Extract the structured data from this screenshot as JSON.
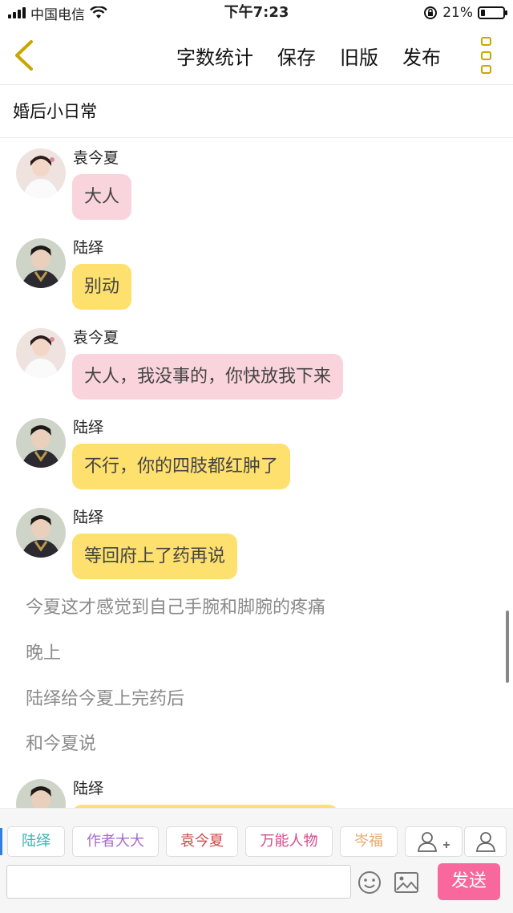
{
  "status_bar": {
    "carrier": "中国电信",
    "time": "下午7:23",
    "battery": "21%",
    "battery_level": 0.21
  },
  "toolbar": {
    "word_count_label": "字数统计",
    "save_label": "保存",
    "old_version_label": "旧版",
    "publish_label": "发布"
  },
  "story": {
    "title": "婚后小日常"
  },
  "messages": [
    {
      "speaker": "袁今夏",
      "text": "大人",
      "style": "pink"
    },
    {
      "speaker": "陆绎",
      "text": "别动",
      "style": "yellow"
    },
    {
      "speaker": "袁今夏",
      "text": "大人，我没事的，你快放我下来",
      "style": "pink"
    },
    {
      "speaker": "陆绎",
      "text": "不行，你的四肢都红肿了",
      "style": "yellow"
    },
    {
      "speaker": "陆绎",
      "text": "等回府上了药再说",
      "style": "yellow"
    }
  ],
  "narration": [
    "今夏这才感觉到自己手腕和脚腕的疼痛",
    "晚上",
    "陆绎给今夏上完药后",
    "和今夏说"
  ],
  "last_message": {
    "speaker": "陆绎"
  },
  "characters": [
    {
      "name": "陆绎",
      "color": "#3bb3b3"
    },
    {
      "name": "作者大大",
      "color": "#a66bc9"
    },
    {
      "name": "袁今夏",
      "color": "#c94a4a"
    },
    {
      "name": "万能人物",
      "color": "#d24a8c"
    },
    {
      "name": "岑福",
      "color": "#e6a86b"
    }
  ],
  "add_character_icon": "add-person-icon",
  "single_character_icon": "person-icon",
  "input": {
    "placeholder": "",
    "value": ""
  },
  "send_label": "发送",
  "colors": {
    "pink_bubble": "#fad4dc",
    "yellow_bubble": "#fde06e",
    "send_button": "#f8689c",
    "menu_accent": "#c9a600"
  }
}
